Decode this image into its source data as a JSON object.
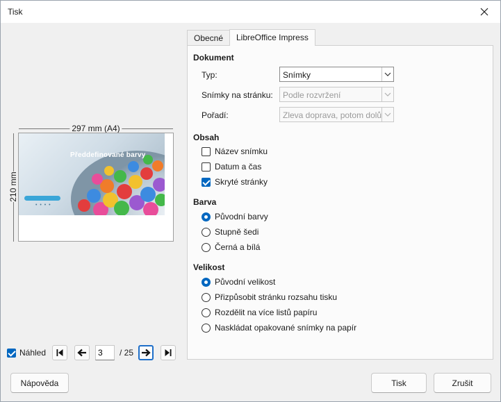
{
  "window": {
    "title": "Tisk",
    "close_icon": "close-icon"
  },
  "preview": {
    "width_label": "297 mm (A4)",
    "height_label": "210 mm",
    "slide_title": "Předdefinované barvy",
    "slide_dots": "• • • •",
    "show_preview_label": "Náhled",
    "show_preview_checked": true,
    "current_page": "3",
    "total_pages": "/ 25"
  },
  "tabs": [
    {
      "label": "Obecné",
      "active": false
    },
    {
      "label": "LibreOffice Impress",
      "active": true
    }
  ],
  "document": {
    "heading": "Dokument",
    "type_label": "Typ:",
    "type_value": "Snímky",
    "slides_per_page_label": "Snímky na stránku:",
    "slides_per_page_value": "Podle rozvržení",
    "order_label": "Pořadí:",
    "order_value": "Zleva doprava, potom dolů"
  },
  "contents": {
    "heading": "Obsah",
    "items": [
      {
        "label": "Název snímku",
        "checked": false
      },
      {
        "label": "Datum a čas",
        "checked": false
      },
      {
        "label": "Skryté stránky",
        "checked": true
      }
    ]
  },
  "color": {
    "heading": "Barva",
    "options": [
      {
        "label": "Původní barvy",
        "selected": true
      },
      {
        "label": "Stupně šedi",
        "selected": false
      },
      {
        "label": "Černá a bílá",
        "selected": false
      }
    ]
  },
  "size": {
    "heading": "Velikost",
    "options": [
      {
        "label": "Původní velikost",
        "selected": true
      },
      {
        "label": "Přizpůsobit stránku rozsahu tisku",
        "selected": false
      },
      {
        "label": "Rozdělit na více listů papíru",
        "selected": false
      },
      {
        "label": "Naskládat opakované snímky na papír",
        "selected": false
      }
    ]
  },
  "buttons": {
    "help": "Nápověda",
    "print": "Tisk",
    "cancel": "Zrušit"
  },
  "colors": {
    "accent": "#0067c0",
    "focus_border": "#1e6fc9"
  }
}
